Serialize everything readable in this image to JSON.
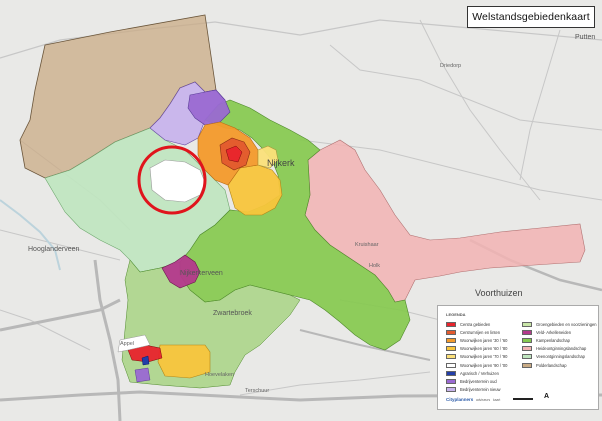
{
  "title": "Welstandsgebiedenkaart",
  "colors": {
    "background": "#e9e9e7",
    "road": "#c7c7c7",
    "mainroad": "#b8b8b8",
    "water": "#bcd3dc",
    "highlight_circle": "#e0141c"
  },
  "places": {
    "putten": "Putten",
    "nijkerk": "Nijkerk",
    "hoogland": "Hooglanderveen",
    "nijkerkerveen": "Nijkerkerveen",
    "zwartebroek": "Zwartebroek",
    "voorthuizen": "Voorthuizen",
    "terschuur": "Terschuur",
    "hoevelaken": "Hoevelaken",
    "kruishaar": "Kruishaar",
    "holk": "Holk",
    "appel": "Appel",
    "driedorp": "Driedorp"
  },
  "legend": {
    "heading": "LEGENDA",
    "left": [
      {
        "label": "Centra gebieden",
        "color": "#e8242c"
      },
      {
        "label": "Centrumrijen en linten",
        "color": "#e25a2e"
      },
      {
        "label": "Woonwijken jaren '30 / '60",
        "color": "#f39a2b"
      },
      {
        "label": "Woonwijken jaren '60 / '80",
        "color": "#f8c53c"
      },
      {
        "label": "Woonwijken jaren '70 / '90",
        "color": "#fbe07a"
      },
      {
        "label": "Woonwijken jaren '90 / '00",
        "color": "#ffffff"
      },
      {
        "label": "Agrarisch / Verhuizen",
        "color": "#233ea8"
      },
      {
        "label": "Bedrijventerrein oud",
        "color": "#9a69d2"
      },
      {
        "label": "Bedrijventerrein nieuw",
        "color": "#c8b4ec"
      }
    ],
    "right": [
      {
        "label": "Groengebieden en voorzieningen",
        "color": "#c9e6a8"
      },
      {
        "label": "Veld- Arkelleneiden",
        "color": "#b4398c"
      },
      {
        "label": "Kampenlandschap",
        "color": "#85c94f"
      },
      {
        "label": "Heideontginningslandschap",
        "color": "#f2b3b3"
      },
      {
        "label": "Veenontginningslandschap",
        "color": "#bfe6bf"
      },
      {
        "label": "Polderlandschap",
        "color": "#c9ab85"
      }
    ],
    "logo": "Cityplanners",
    "credit1": "adviseurs",
    "credit2": "kaart",
    "north": "A"
  }
}
